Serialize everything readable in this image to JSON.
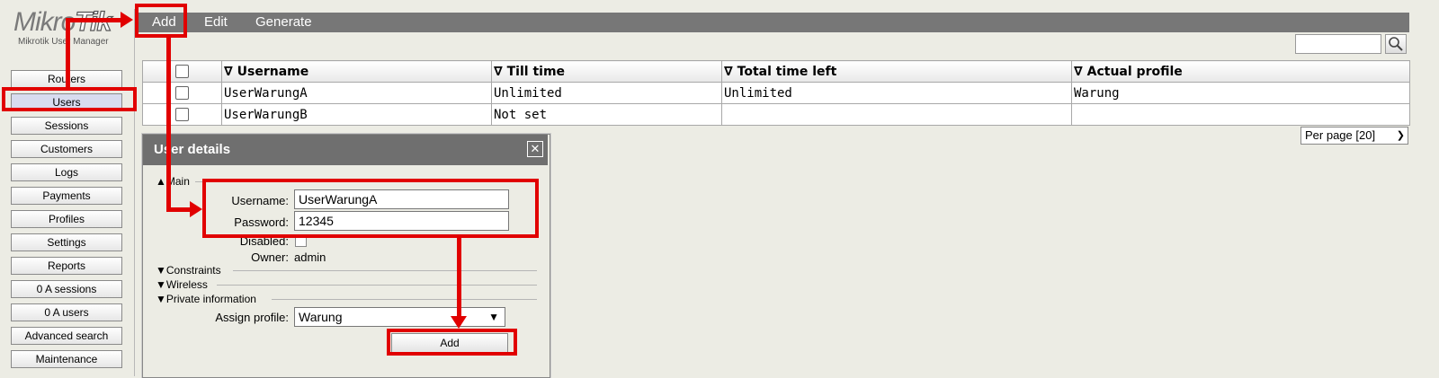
{
  "logo": {
    "brand_main": "Mikro",
    "brand_accent": "Tik",
    "subtitle": "Mikrotik User Manager"
  },
  "sidebar": {
    "items": [
      {
        "label": "Routers"
      },
      {
        "label": "Users"
      },
      {
        "label": "Sessions"
      },
      {
        "label": "Customers"
      },
      {
        "label": "Logs"
      },
      {
        "label": "Payments"
      },
      {
        "label": "Profiles"
      },
      {
        "label": "Settings"
      },
      {
        "label": "Reports"
      },
      {
        "label": "0 A sessions"
      },
      {
        "label": "0 A users"
      },
      {
        "label": "Advanced search"
      },
      {
        "label": "Maintenance"
      }
    ]
  },
  "menu": {
    "add": "Add",
    "edit": "Edit",
    "generate": "Generate"
  },
  "search": {
    "placeholder": "",
    "icon": "magnifier-icon"
  },
  "table": {
    "columns": [
      "∇ Username",
      "∇ Till time",
      "∇ Total time left",
      "∇ Actual profile"
    ],
    "rows": [
      {
        "username": "UserWarungA",
        "till": "Unlimited",
        "total": "Unlimited",
        "profile": "Warung"
      },
      {
        "username": "UserWarungB",
        "till": "Not set",
        "total": "",
        "profile": ""
      }
    ]
  },
  "perpage": {
    "value": "Per page [20]"
  },
  "dialog": {
    "title": "User details",
    "sections": {
      "main": "Main",
      "constraints": "Constraints",
      "wireless": "Wireless",
      "private": "Private information"
    },
    "labels": {
      "username": "Username:",
      "password": "Password:",
      "disabled": "Disabled:",
      "owner": "Owner:",
      "assign_profile": "Assign profile:"
    },
    "values": {
      "username": "UserWarungA",
      "password": "12345",
      "owner": "admin",
      "assign_profile": "Warung"
    },
    "add_button": "Add"
  },
  "colors": {
    "annotation": "#e10000",
    "menubar": "#777777",
    "dialog_header": "#6f6f6f"
  }
}
